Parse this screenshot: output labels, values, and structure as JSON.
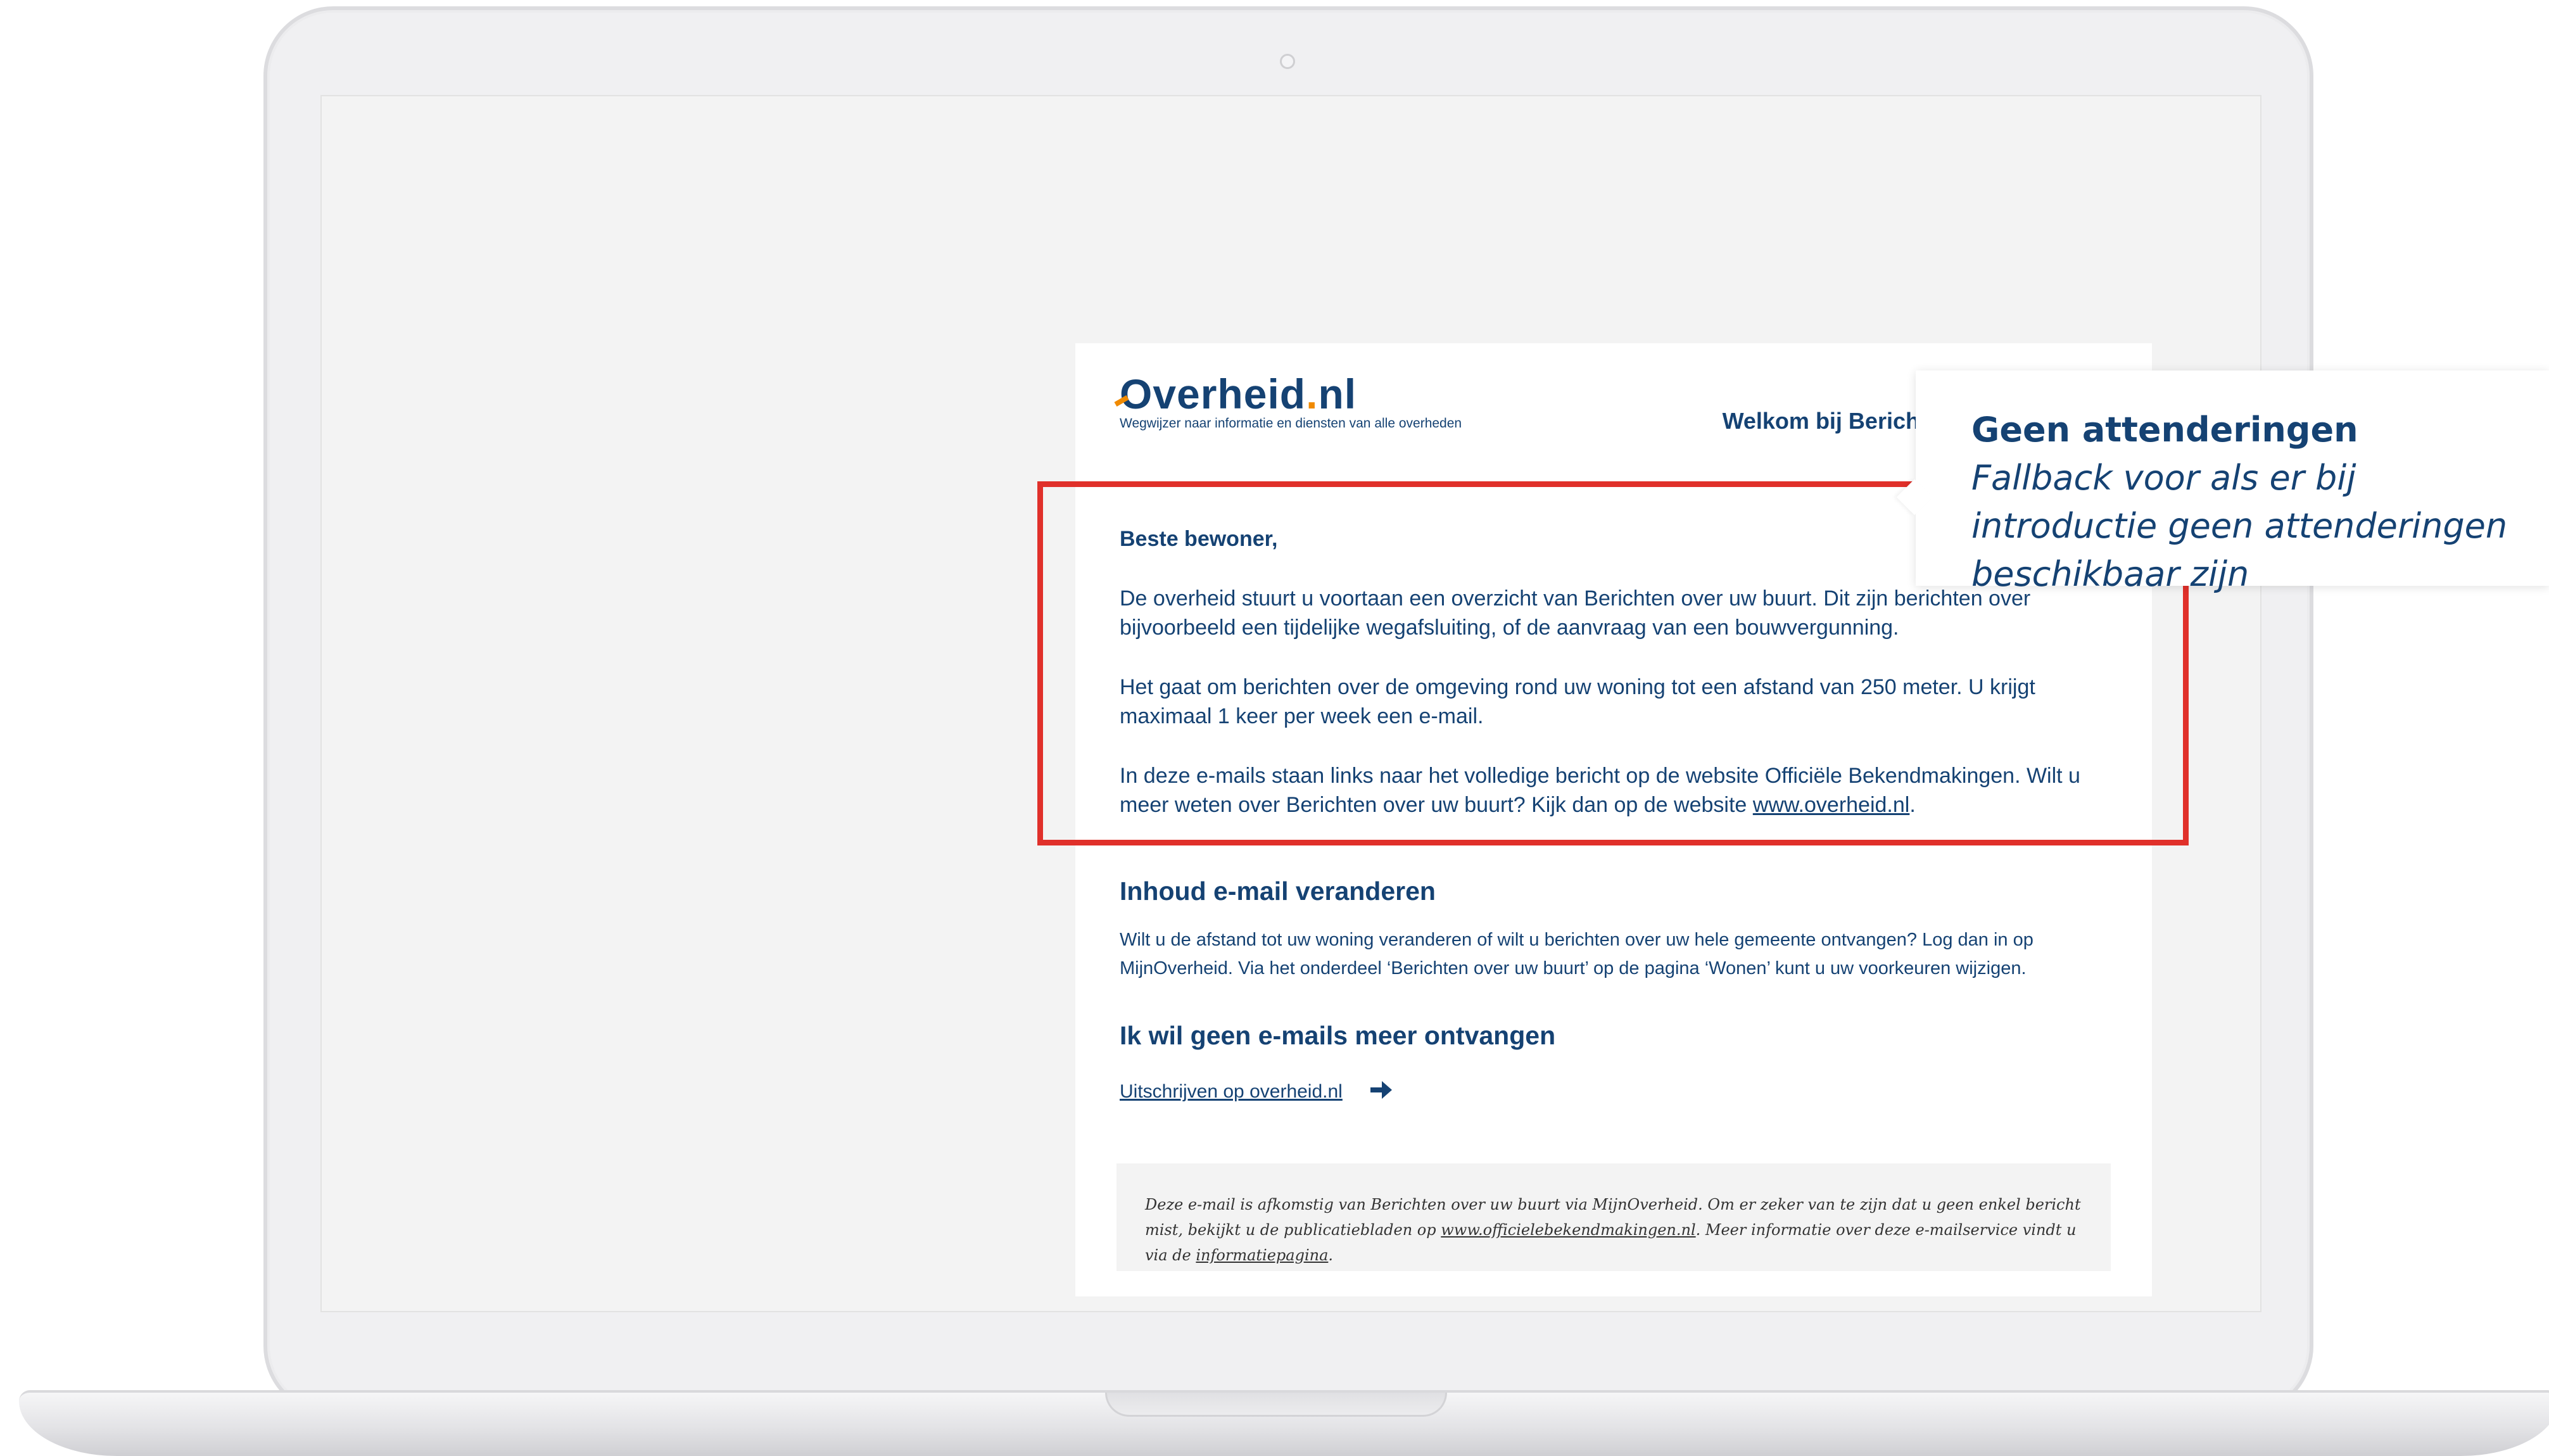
{
  "email": {
    "logo_text": "Overheid",
    "logo_suffix": "nl",
    "logo_tagline": "Wegwijzer naar informatie en diensten van alle overheden",
    "welcome_title": "Welkom bij Berichten over uw buurt",
    "greeting": "Beste bewoner,",
    "paragraph1": "De overheid stuurt u voortaan een overzicht van Berichten over uw buurt. Dit zijn berichten over bijvoorbeeld een tijdelijke wegafsluiting, of de aanvraag van een bouwvergunning.",
    "paragraph2": "Het gaat om berichten over de omgeving rond uw woning tot een afstand van 250 meter. U krijgt maximaal 1 keer per week een e-mail.",
    "paragraph3_prefix": "In deze e-mails staan links naar het volledige bericht op de website Officiële Bekendmakingen. Wilt u meer weten over Berichten over uw buurt? Kijk dan op de website ",
    "paragraph3_link": "www.overheid.nl",
    "paragraph3_suffix": ".",
    "section1_title": "Inhoud e-mail veranderen",
    "section1_text": "Wilt u de afstand tot uw woning veranderen of wilt u berichten over uw hele gemeente ontvangen? Log dan in op MijnOverheid. Via het onderdeel ‘Berichten over uw buurt’ op de pagina ‘Wonen’ kunt u uw voorkeuren wijzigen.",
    "section2_title": "Ik wil geen e-mails meer ontvangen",
    "unsubscribe_link": "Uitschrijven op overheid.nl",
    "footer_prefix": "Deze e-mail is afkomstig van Berichten over uw buurt via MijnOverheid. Om er zeker van te zijn dat u geen enkel bericht mist, bekijkt u de publicatiebladen op ",
    "footer_link1": "www.officielebekendmakingen.nl",
    "footer_middle": ". Meer informatie over deze e-mailservice vindt u via de ",
    "footer_link2": "informatiepagina",
    "footer_suffix": "."
  },
  "annotation": {
    "title": "Geen attenderingen",
    "body": "Fallback voor als er bij introductie geen attenderingen beschikbaar zijn"
  },
  "colors": {
    "brand_blue": "#154273",
    "brand_orange": "#f08a00",
    "highlight_red": "#e0302a"
  },
  "icons": {
    "unsubscribe_arrow": "arrow-right-icon"
  }
}
